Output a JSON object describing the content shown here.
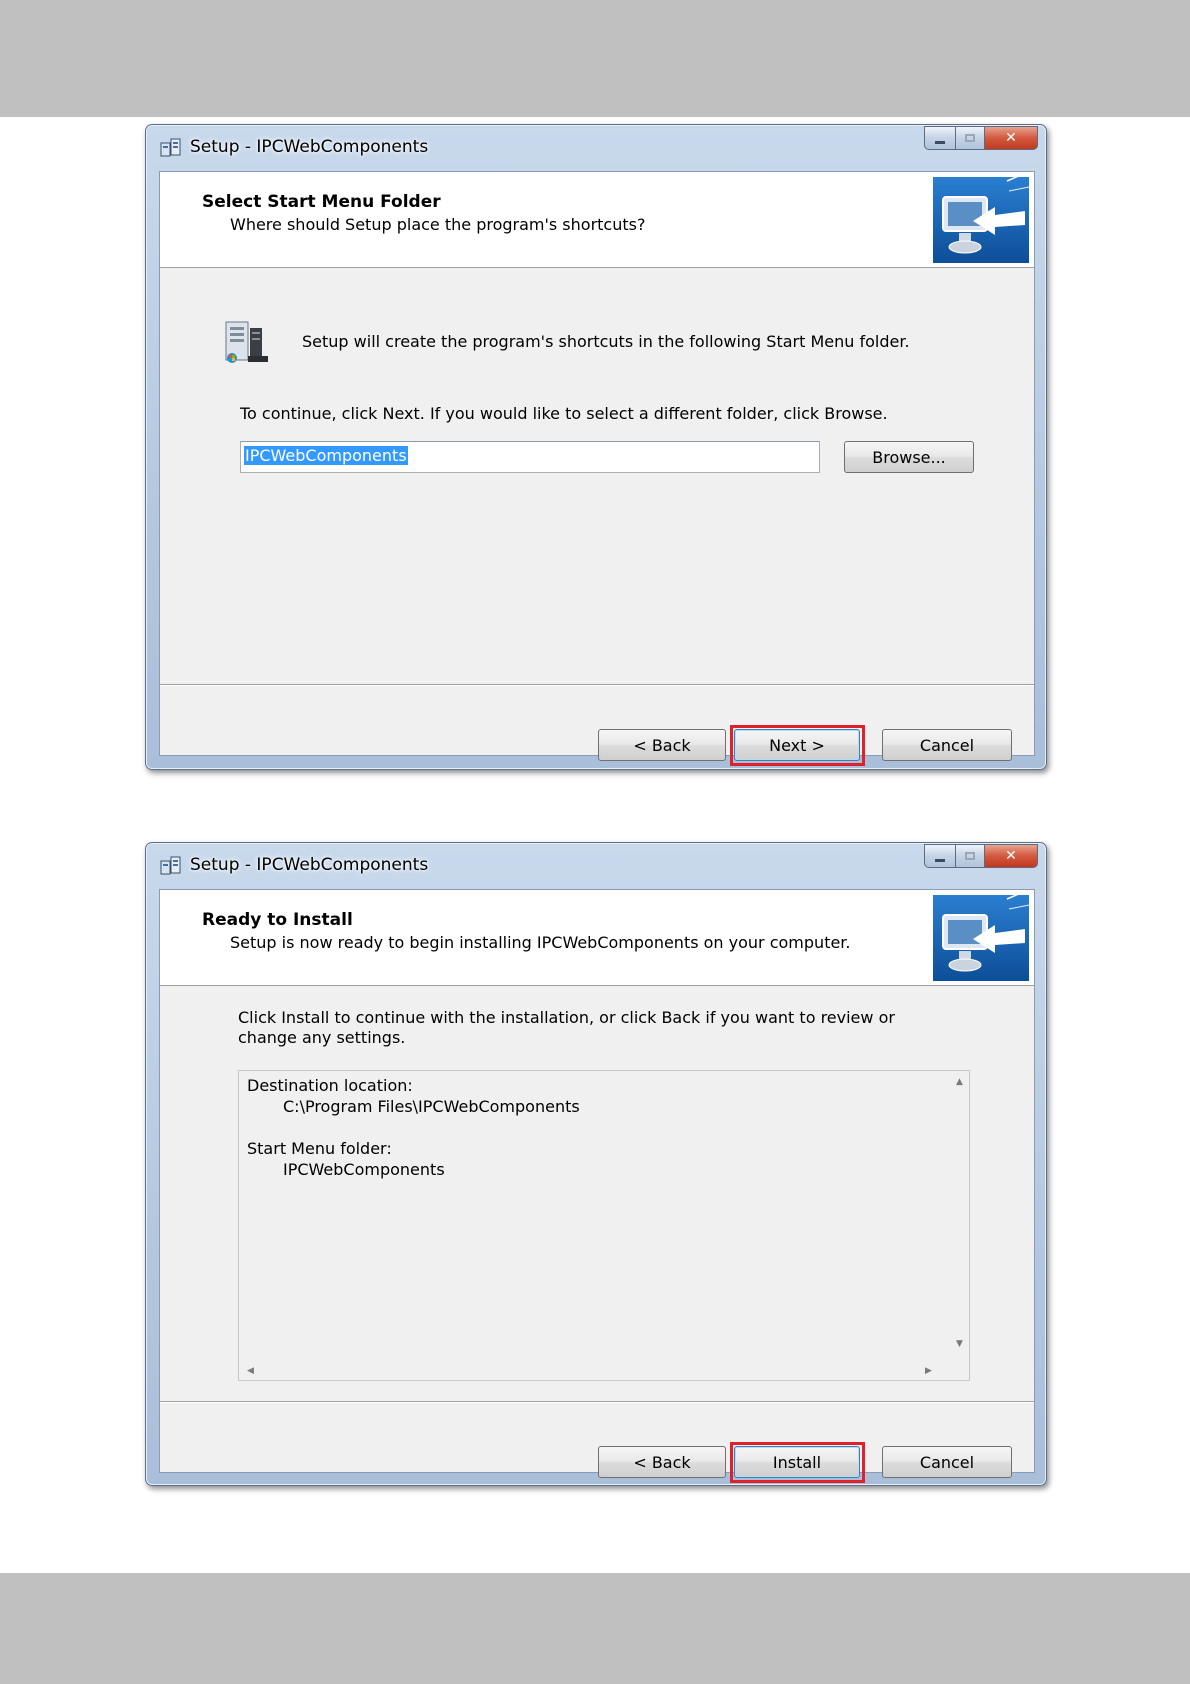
{
  "page": {
    "background_band_color": "#c0c0c0"
  },
  "dialog1": {
    "title": "Setup - IPCWebComponents",
    "header_title": "Select Start Menu Folder",
    "header_subtitle": "Where should Setup place the program's shortcuts?",
    "intro_text": "Setup will create the program's shortcuts in the following Start Menu folder.",
    "continue_text": "To continue, click Next. If you would like to select a different folder, click Browse.",
    "folder_value": "IPCWebComponents",
    "browse_label": "Browse...",
    "back_label": "< Back",
    "next_label": "Next >",
    "cancel_label": "Cancel",
    "highlighted_button": "next"
  },
  "dialog2": {
    "title": "Setup - IPCWebComponents",
    "header_title": "Ready to Install",
    "header_subtitle": "Setup is now ready to begin installing IPCWebComponents on your computer.",
    "body_line1": "Click Install to continue with the installation, or click Back if you want to review or",
    "body_line2": "change any settings.",
    "memo": {
      "dest_label": "Destination location:",
      "dest_value": "C:\\Program Files\\IPCWebComponents",
      "startmenu_label": "Start Menu folder:",
      "startmenu_value": "IPCWebComponents"
    },
    "back_label": "< Back",
    "install_label": "Install",
    "cancel_label": "Cancel",
    "highlighted_button": "install"
  },
  "colors": {
    "highlight": "#e0212b",
    "selection": "#3399ff",
    "close_button": "#c2391f"
  },
  "icons": [
    "setup-app-icon",
    "minimize-icon",
    "maximize-icon",
    "close-icon",
    "wizard-monitor-icon",
    "start-menu-folder-icon",
    "scroll-up-icon",
    "scroll-down-icon",
    "scroll-left-icon",
    "scroll-right-icon"
  ]
}
